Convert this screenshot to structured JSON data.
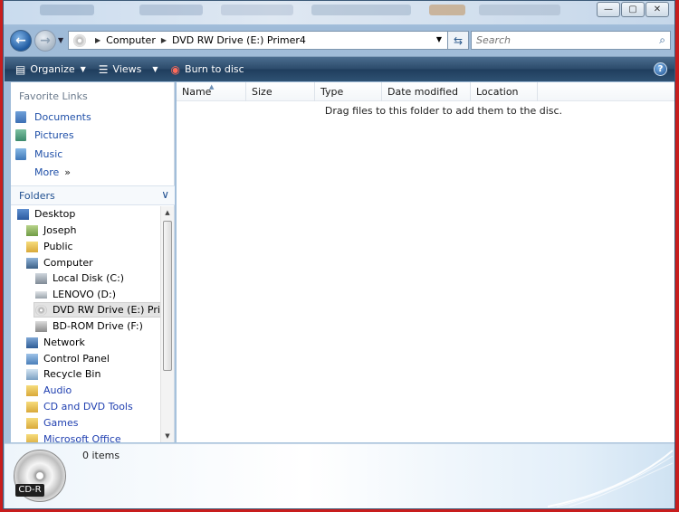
{
  "window": {
    "caption_buttons": [
      "minimize-icon",
      "maximize-icon",
      "close-icon"
    ]
  },
  "address": {
    "segments": [
      "Computer",
      "DVD RW Drive (E:) Primer4"
    ],
    "search_placeholder": "Search"
  },
  "toolbar": {
    "organize": "Organize",
    "views": "Views",
    "burn": "Burn to disc"
  },
  "favorites": {
    "title": "Favorite Links",
    "items": [
      "Documents",
      "Pictures",
      "Music",
      "More"
    ]
  },
  "folders": {
    "title": "Folders",
    "tree": [
      {
        "label": "Desktop",
        "icon": "desktop-icon"
      },
      {
        "label": "Joseph",
        "icon": "user-folder-icon"
      },
      {
        "label": "Public",
        "icon": "folder-icon"
      },
      {
        "label": "Computer",
        "icon": "computer-icon"
      },
      {
        "label": "Local Disk (C:)",
        "icon": "hard-disk-icon"
      },
      {
        "label": "LENOVO (D:)",
        "icon": "drive-icon"
      },
      {
        "label": "DVD RW Drive (E:) Primer4",
        "icon": "dvd-drive-icon",
        "selected": true
      },
      {
        "label": "BD-ROM Drive (F:)",
        "icon": "bd-rom-icon"
      },
      {
        "label": "Network",
        "icon": "network-icon"
      },
      {
        "label": "Control Panel",
        "icon": "control-panel-icon"
      },
      {
        "label": "Recycle Bin",
        "icon": "recycle-bin-icon"
      },
      {
        "label": "Audio",
        "icon": "folder-icon"
      },
      {
        "label": "CD and DVD Tools",
        "icon": "folder-icon"
      },
      {
        "label": "Games",
        "icon": "folder-icon"
      },
      {
        "label": "Microsoft Office",
        "icon": "folder-icon"
      }
    ]
  },
  "columns": [
    "Name",
    "Size",
    "Type",
    "Date modified",
    "Location"
  ],
  "content": {
    "empty_message": "Drag files to this folder to add them to the disc."
  },
  "details": {
    "disc_label": "CD-R",
    "item_count": "0 items"
  }
}
